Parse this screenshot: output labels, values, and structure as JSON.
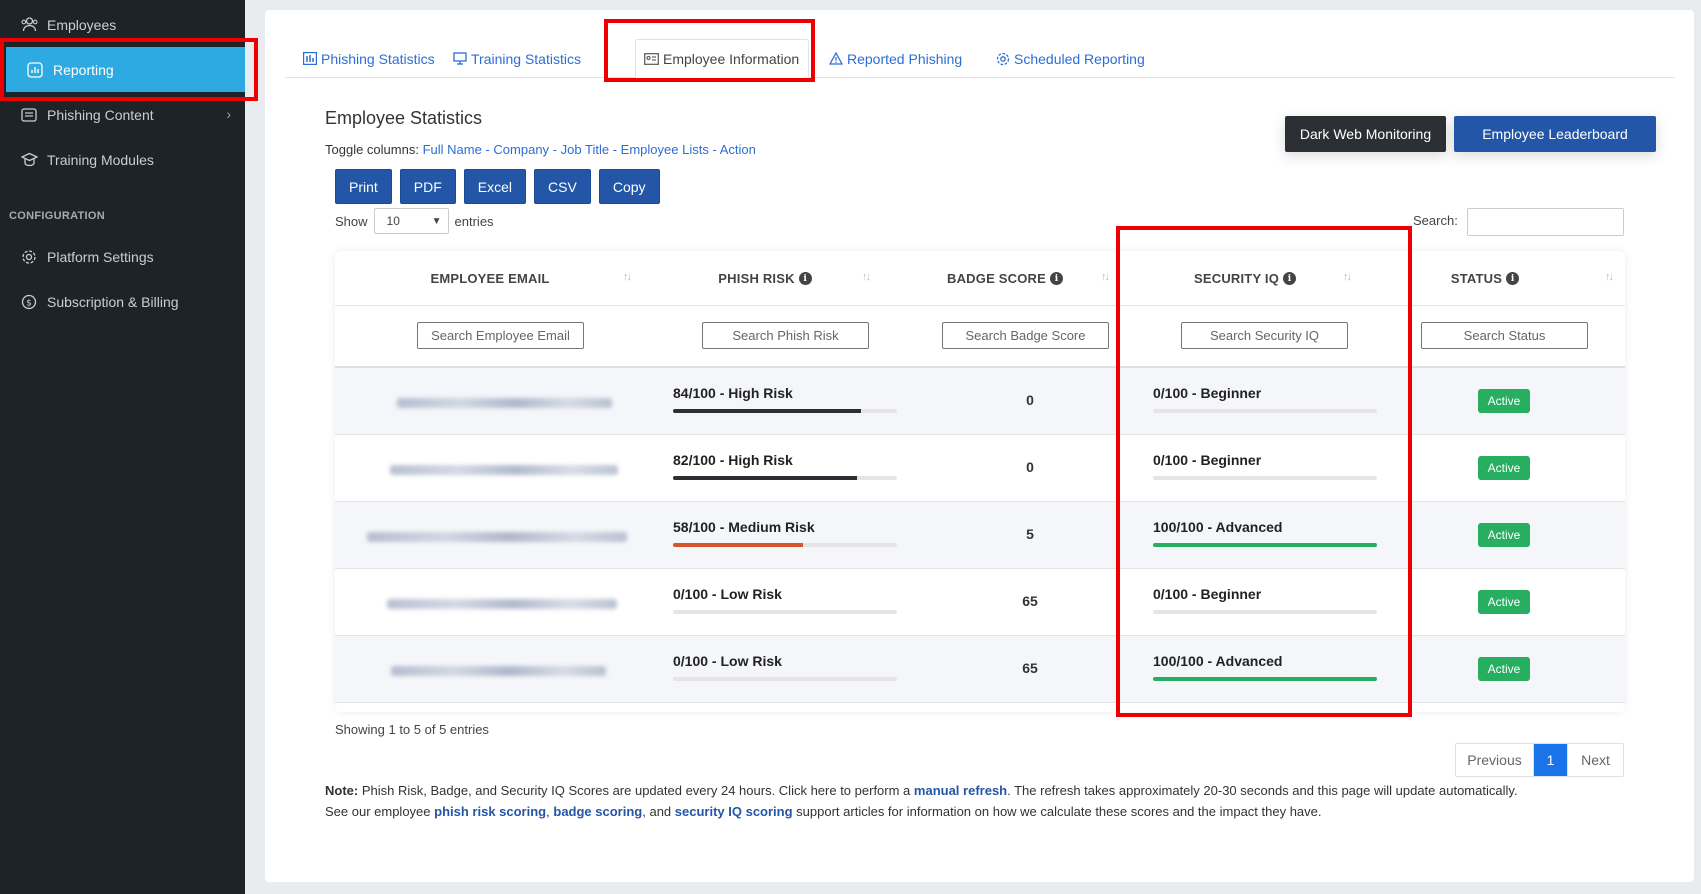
{
  "sidebar": {
    "items": [
      {
        "label": "Employees",
        "icon": "users-icon"
      },
      {
        "label": "Reporting",
        "icon": "chart-icon"
      },
      {
        "label": "Phishing Content",
        "icon": "mail-stack-icon"
      },
      {
        "label": "Training Modules",
        "icon": "graduation-cap-icon"
      }
    ],
    "section_label": "CONFIGURATION",
    "config_items": [
      {
        "label": "Platform Settings",
        "icon": "gear-icon"
      },
      {
        "label": "Subscription & Billing",
        "icon": "dollar-icon"
      }
    ]
  },
  "tabs": [
    {
      "label": "Phishing Statistics",
      "icon": "bar-chart-icon"
    },
    {
      "label": "Training Statistics",
      "icon": "monitor-icon"
    },
    {
      "label": "Employee Information",
      "icon": "id-card-icon"
    },
    {
      "label": "Reported Phishing",
      "icon": "warning-icon"
    },
    {
      "label": "Scheduled Reporting",
      "icon": "gear-icon"
    }
  ],
  "main": {
    "title": "Employee Statistics",
    "toggle_prefix": "Toggle columns:",
    "toggle_columns": [
      "Full Name",
      "Company",
      "Job Title",
      "Employee Lists",
      "Action"
    ],
    "toggle_sep": "-",
    "export_buttons": [
      "Print",
      "PDF",
      "Excel",
      "CSV",
      "Copy"
    ],
    "dark_web_button": "Dark Web Monitoring",
    "leaderboard_button": "Employee Leaderboard",
    "show_label": "Show",
    "show_value": "10",
    "entries_label": "entries",
    "search_label": "Search:"
  },
  "table": {
    "headers": [
      "EMPLOYEE EMAIL",
      "PHISH RISK",
      "BADGE SCORE",
      "SECURITY IQ",
      "STATUS"
    ],
    "filters": [
      "Search Employee Email",
      "Search Phish Risk",
      "Search Badge Score",
      "Search Security IQ",
      "Search Status"
    ],
    "rows": [
      {
        "phish_risk": "84/100 - High Risk",
        "phish_value": 84,
        "badge": "0",
        "iq": "0/100 - Beginner",
        "iq_value": 0,
        "status": "Active"
      },
      {
        "phish_risk": "82/100 - High Risk",
        "phish_value": 82,
        "badge": "0",
        "iq": "0/100 - Beginner",
        "iq_value": 0,
        "status": "Active"
      },
      {
        "phish_risk": "58/100 - Medium Risk",
        "phish_value": 58,
        "badge": "5",
        "iq": "100/100 - Advanced",
        "iq_value": 100,
        "status": "Active"
      },
      {
        "phish_risk": "0/100 - Low Risk",
        "phish_value": 0,
        "badge": "65",
        "iq": "0/100 - Beginner",
        "iq_value": 0,
        "status": "Active"
      },
      {
        "phish_risk": "0/100 - Low Risk",
        "phish_value": 0,
        "badge": "65",
        "iq": "100/100 - Advanced",
        "iq_value": 100,
        "status": "Active"
      }
    ]
  },
  "footer": {
    "showing": "Showing 1 to 5 of 5 entries",
    "prev": "Previous",
    "page": "1",
    "next": "Next",
    "note_label": "Note:",
    "note_text1": "Phish Risk, Badge, and Security IQ Scores are updated every 24 hours. Click here to perform a",
    "manual_refresh": "manual refresh",
    "note_text2": ". The refresh takes approximately 20-30 seconds and this page will update automatically.",
    "note_text3": "See our employee",
    "link_phish": "phish risk scoring",
    "comma": ",",
    "link_badge": "badge scoring",
    "and": ", and",
    "link_iq": "security IQ scoring",
    "note_text4": "support articles for information on how we calculate these scores and the impact they have."
  },
  "colors": {
    "high_risk": "#2c3034",
    "medium_risk": "#d4562a",
    "advanced": "#27ae60",
    "accent": "#2daae1",
    "primary": "#2356a6"
  }
}
